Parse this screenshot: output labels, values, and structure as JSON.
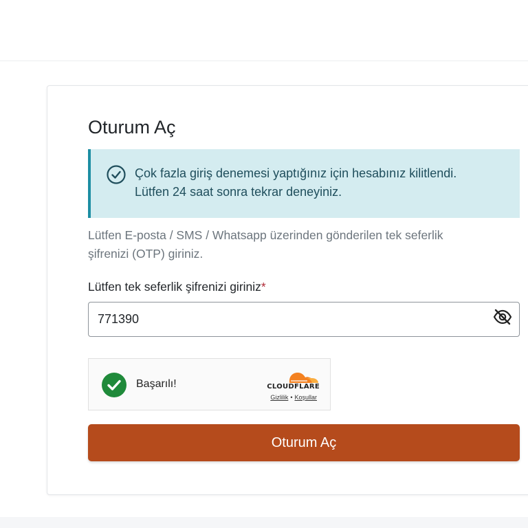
{
  "login": {
    "title": "Oturum Aç",
    "alert": {
      "line1": "Çok fazla giriş denemesi yaptığınız için hesabınız kilitlendi.",
      "line2": "Lütfen 24 saat sonra tekrar deneyiniz.",
      "icon": "check-circle-icon",
      "color": "#1d8ea3"
    },
    "info": {
      "line1": "Lütfen E-posta / SMS / Whatsapp üzerinden gönderilen tek seferlik",
      "line2": "şifrenizi (OTP) giriniz."
    },
    "otp_field": {
      "label": "Lütfen tek seferlik şifrenizi giriniz",
      "required_mark": "*",
      "value": "771390",
      "toggle_icon": "eye-slash-icon"
    },
    "captcha": {
      "status": "Başarılı!",
      "brand": "CLOUDFLARE",
      "privacy_link": "Gizlilik",
      "separator": "•",
      "terms_link": "Koşullar",
      "check_color": "#1f8a3a",
      "brand_color": "#f48120"
    },
    "submit_label": "Oturum Aç",
    "submit_color": "#b54b1c"
  }
}
